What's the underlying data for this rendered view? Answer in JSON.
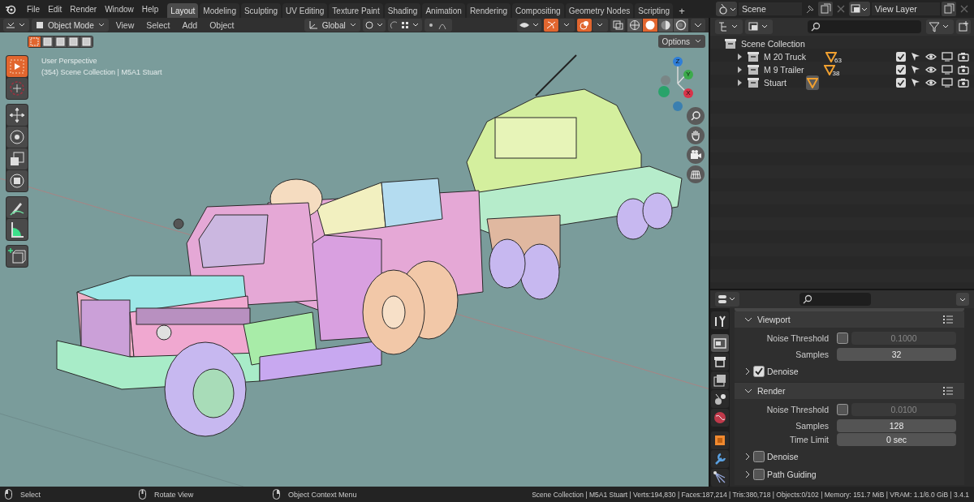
{
  "top_bar": {
    "menus": [
      "File",
      "Edit",
      "Render",
      "Window",
      "Help"
    ],
    "workspaces": [
      {
        "label": "Layout",
        "selected": true
      },
      {
        "label": "Modeling",
        "selected": false
      },
      {
        "label": "Sculpting",
        "selected": false
      },
      {
        "label": "UV Editing",
        "selected": false
      },
      {
        "label": "Texture Paint",
        "selected": false
      },
      {
        "label": "Shading",
        "selected": false
      },
      {
        "label": "Animation",
        "selected": false
      },
      {
        "label": "Rendering",
        "selected": false
      },
      {
        "label": "Compositing",
        "selected": false
      },
      {
        "label": "Geometry Nodes",
        "selected": false
      },
      {
        "label": "Scripting",
        "selected": false
      }
    ],
    "add_workspace": "+",
    "scene": "Scene",
    "view_layer": "View Layer"
  },
  "viewport": {
    "mode": "Object Mode",
    "menus": [
      "View",
      "Select",
      "Add",
      "Object"
    ],
    "orientation": "Global",
    "shading": [
      {
        "kind": "wireframe",
        "selected": false
      },
      {
        "kind": "solid",
        "selected": true
      },
      {
        "kind": "material",
        "selected": false
      },
      {
        "kind": "rendered",
        "selected": false
      }
    ],
    "select_modes": [
      {
        "selected": true
      },
      {
        "selected": false
      },
      {
        "selected": false
      },
      {
        "selected": false
      },
      {
        "selected": false
      }
    ],
    "info": [
      "User Perspective",
      "(354) Scene Collection | M5A1 Stuart"
    ],
    "options": "Options",
    "axes": [
      "Z",
      "Y",
      "X"
    ],
    "tools": [
      {
        "kind": "select",
        "selected": true
      },
      {
        "kind": "cursor",
        "selected": false
      },
      {
        "kind": "move",
        "selected": false
      },
      {
        "kind": "rotate",
        "selected": false
      },
      {
        "kind": "scale",
        "selected": false
      },
      {
        "kind": "transform",
        "selected": false
      },
      {
        "kind": "annotate",
        "selected": false
      },
      {
        "kind": "measure",
        "selected": false
      },
      {
        "kind": "add-cube",
        "selected": false
      }
    ]
  },
  "outliner": {
    "root": "Scene Collection",
    "collections": [
      {
        "name": "M 20 Truck",
        "badge": "63",
        "expanded": false,
        "checked": true
      },
      {
        "name": "M 9 Trailer",
        "badge": "38",
        "expanded": false,
        "checked": true
      },
      {
        "name": "Stuart",
        "expanded": false,
        "checked": true
      }
    ]
  },
  "properties": {
    "tabs": [
      {
        "kind": "tool",
        "selected": false
      },
      {
        "kind": "render",
        "selected": true
      },
      {
        "kind": "output",
        "selected": false
      },
      {
        "kind": "view-layer",
        "selected": false
      },
      {
        "kind": "scene",
        "selected": false
      },
      {
        "kind": "world",
        "selected": false
      },
      {
        "kind": "object",
        "selected": false
      },
      {
        "kind": "modifier",
        "selected": false
      },
      {
        "kind": "particles",
        "selected": false
      }
    ],
    "panels": [
      {
        "title": "Viewport",
        "expanded": true,
        "rows": [
          {
            "kind": "toggle-value",
            "label": "Noise Threshold",
            "checked": false,
            "disabled": true,
            "value": "0.1000"
          },
          {
            "kind": "value",
            "label": "Samples",
            "value": "32"
          },
          {
            "kind": "subpanel",
            "label": "Denoise",
            "checked": true
          }
        ]
      },
      {
        "title": "Render",
        "expanded": true,
        "rows": [
          {
            "kind": "toggle-value",
            "label": "Noise Threshold",
            "checked": false,
            "disabled": true,
            "value": "0.0100"
          },
          {
            "kind": "value",
            "label": "Samples",
            "value": "128"
          },
          {
            "kind": "value",
            "label": "Time Limit",
            "value": "0 sec"
          },
          {
            "kind": "subpanel",
            "label": "Denoise",
            "checked": false
          },
          {
            "kind": "subpanel",
            "label": "Path Guiding",
            "checked": false
          }
        ]
      }
    ]
  },
  "status_bar": {
    "hints": [
      "Select",
      "Rotate View",
      "Object Context Menu"
    ],
    "stats": "Scene Collection | M5A1 Stuart | Verts:194,830 | Faces:187,214 | Tris:380,718 | Objects:0/102 | Memory: 151.7 MiB | VRAM: 1.1/6.0 GiB | 3.4.1"
  }
}
